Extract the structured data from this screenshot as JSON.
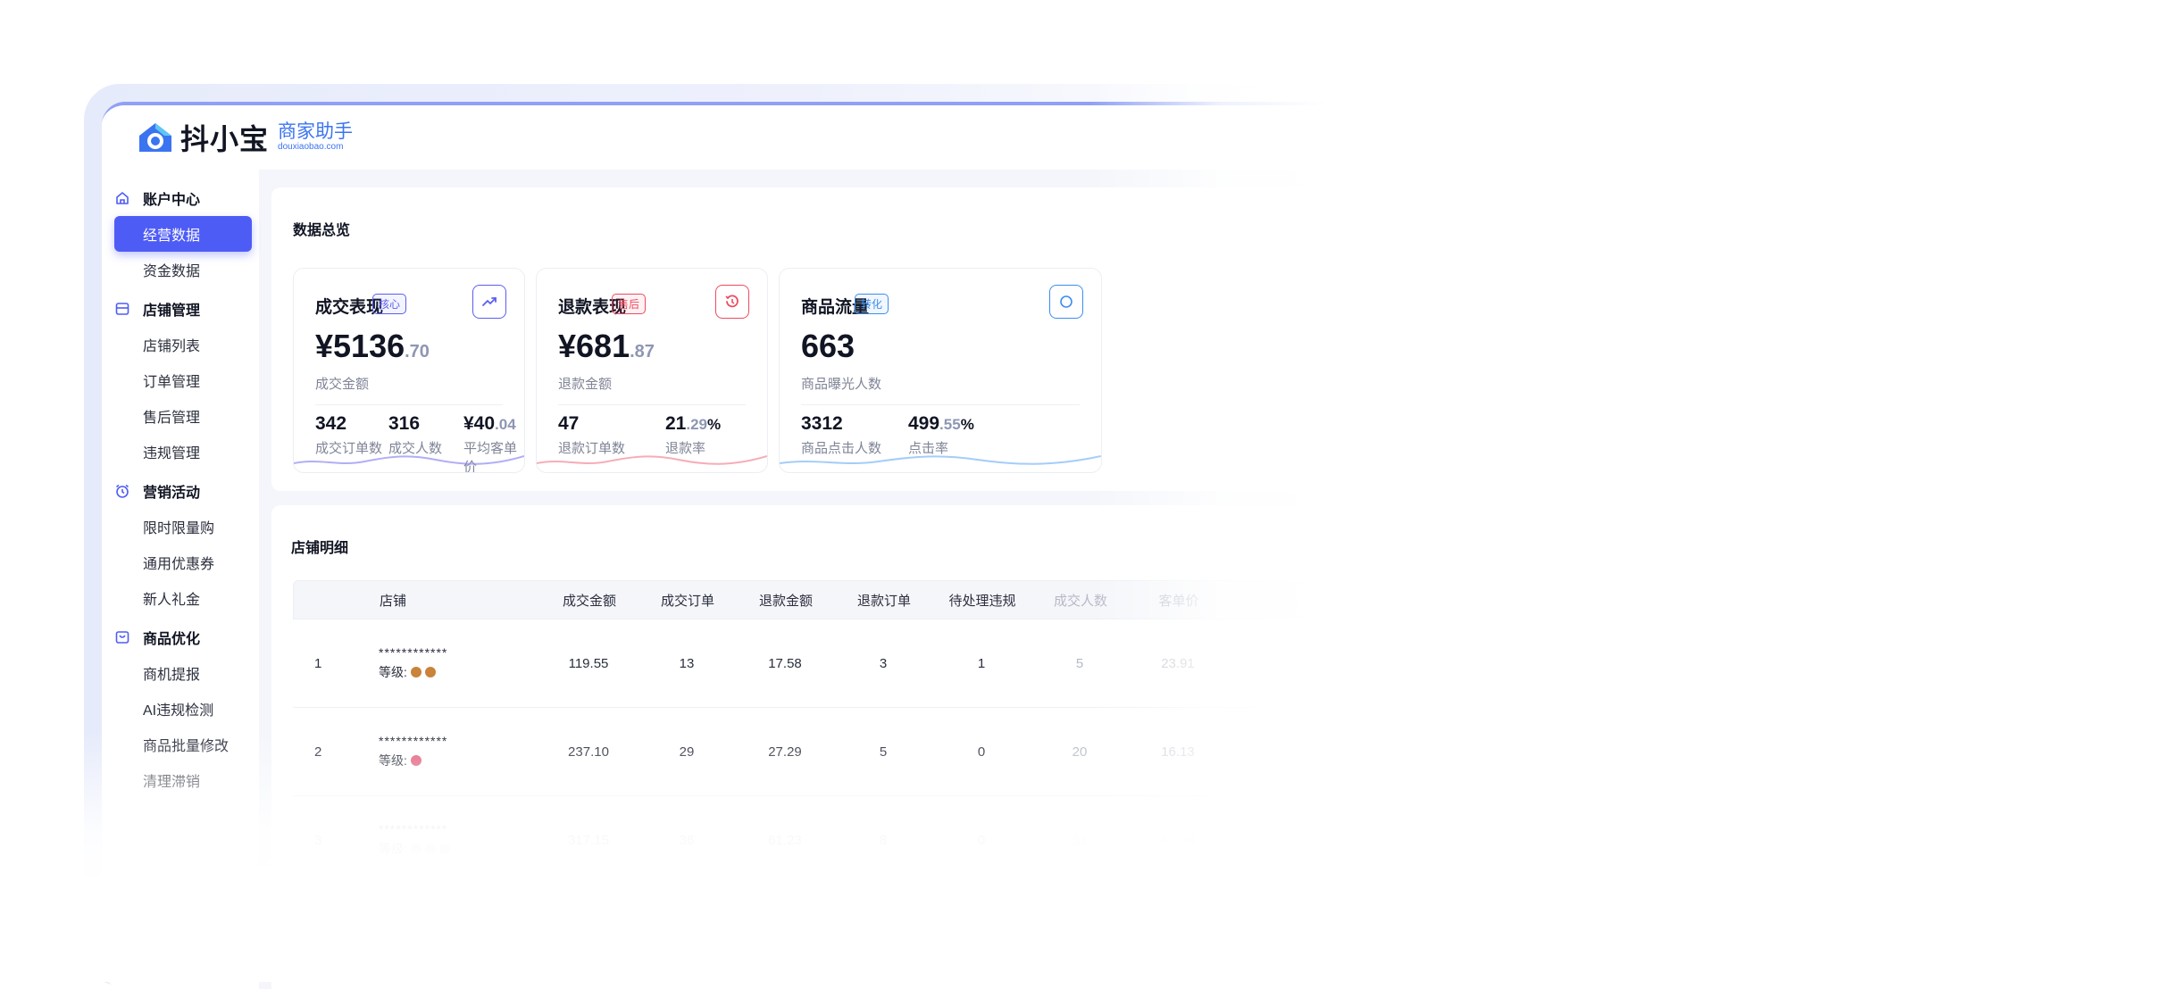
{
  "brand": {
    "name": "抖小宝",
    "subtitle": "商家助手",
    "url": "douxiaobao.com",
    "accent": "#4e5cf6",
    "brand_blue": "#3b74f0"
  },
  "sidebar": {
    "groups": [
      {
        "title": "账户中心",
        "icon": "home-icon",
        "items": [
          {
            "label": "经营数据",
            "active": true
          },
          {
            "label": "资金数据"
          }
        ]
      },
      {
        "title": "店铺管理",
        "icon": "store-icon",
        "items": [
          {
            "label": "店铺列表"
          },
          {
            "label": "订单管理"
          },
          {
            "label": "售后管理"
          },
          {
            "label": "违规管理"
          }
        ]
      },
      {
        "title": "营销活动",
        "icon": "alarm-clock-icon",
        "items": [
          {
            "label": "限时限量购"
          },
          {
            "label": "通用优惠券"
          },
          {
            "label": "新人礼金"
          }
        ]
      },
      {
        "title": "商品优化",
        "icon": "shopping-bag-icon",
        "items": [
          {
            "label": "商机提报"
          },
          {
            "label": "AI违规检测"
          },
          {
            "label": "商品批量修改"
          },
          {
            "label": "清理滞销"
          }
        ]
      }
    ]
  },
  "overview": {
    "title": "数据总览",
    "cards": [
      {
        "title": "成交表现",
        "tag": "核心",
        "tag_color": "#5b5ef0",
        "icon": "trend-up-icon",
        "big_int": "¥5136",
        "big_dec": ".70",
        "big_label": "成交金额",
        "stats": [
          {
            "int": "342",
            "dec": "",
            "suffix": "",
            "label": "成交订单数"
          },
          {
            "int": "316",
            "dec": "",
            "suffix": "",
            "label": "成交人数"
          },
          {
            "int": "¥40",
            "dec": ".04",
            "suffix": "",
            "label": "平均客单价"
          }
        ],
        "wave_color": "#8e8cf4"
      },
      {
        "title": "退款表现",
        "tag": "售后",
        "tag_color": "#ef4a5f",
        "icon": "refund-clock-icon",
        "big_int": "¥681",
        "big_dec": ".87",
        "big_label": "退款金额",
        "stats": [
          {
            "int": "47",
            "dec": "",
            "suffix": "",
            "label": "退款订单数"
          },
          {
            "int": "21",
            "dec": ".29",
            "suffix": "%",
            "label": "退款率"
          }
        ],
        "wave_color": "#f28a99"
      },
      {
        "title": "商品流量",
        "tag": "转化",
        "tag_color": "#3b8ef0",
        "icon": "traffic-icon",
        "big_int": "663",
        "big_dec": "",
        "big_label": "商品曝光人数",
        "stats": [
          {
            "int": "3312",
            "dec": "",
            "suffix": "",
            "label": "商品点击人数"
          },
          {
            "int": "499",
            "dec": ".55",
            "suffix": "%",
            "label": "点击率"
          }
        ],
        "wave_color": "#7db8f5"
      }
    ]
  },
  "detail": {
    "title": "店铺明细",
    "level_label": "等级:",
    "columns": [
      "",
      "店铺",
      "成交金额",
      "成交订单",
      "退款金额",
      "退款订单",
      "待处理违规",
      "成交人数",
      "客单价"
    ],
    "rows": [
      {
        "idx": "1",
        "shop": "************",
        "level_colors": [
          "#c9833a",
          "#c9833a"
        ],
        "values": [
          "119.55",
          "13",
          "17.58",
          "3",
          "1",
          "5",
          "23.91"
        ]
      },
      {
        "idx": "2",
        "shop": "************",
        "level_colors": [
          "#e25c7a"
        ],
        "values": [
          "237.10",
          "29",
          "27.29",
          "5",
          "0",
          "20",
          "16.13"
        ]
      },
      {
        "idx": "3",
        "shop": "************",
        "level_colors": [
          "#b8bccb",
          "#b8bccb",
          "#b8bccb"
        ],
        "values": [
          "317.15",
          "36",
          "61.23",
          "8",
          "0",
          "31",
          "12.33"
        ]
      }
    ]
  }
}
